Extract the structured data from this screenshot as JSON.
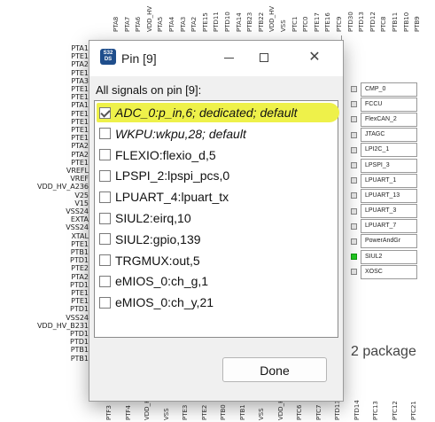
{
  "background": {
    "top_pins": [
      "PTA8",
      "PTA7",
      "PTA6",
      "VDD_HV",
      "PTA5",
      "PTA4",
      "PTA3",
      "PTA2",
      "PTE15",
      "PTD11",
      "PTD10",
      "PTA14",
      "PTB23",
      "PTB22",
      "VDD_HV",
      "VSS",
      "PTC1",
      "PTC0",
      "PTE17",
      "PTE16",
      "PTC9",
      "PTD30",
      "PTD13",
      "PTD12",
      "PTC8",
      "PTB11",
      "PTB10",
      "PTB9"
    ],
    "left_pins": [
      "PTA1",
      "PTE1",
      "PTA2",
      "PTE1",
      "PTA3",
      "PTE1",
      "PTE1",
      "PTA1",
      "PTE1",
      "PTE1",
      "PTE1",
      "PTE1",
      "PTA2",
      "PTA2",
      "PTE1",
      "VREFL",
      "VREF",
      "VDD_HV_A236",
      "V25",
      "V15",
      "VSS24",
      "EXTA",
      "VSS24",
      "XTAL",
      "PTE1",
      "PTB1",
      "PTD1",
      "PTE2",
      "PTA2",
      "PTD1",
      "PTE1",
      "PTE1",
      "PTD1",
      "VSS24",
      "VDD_HV_B231",
      "PTD1",
      "PTD1",
      "PTB1",
      "PTB1"
    ],
    "bottom_pins": [
      "PTF3",
      "PTF4",
      "VDD_HV",
      "VSS",
      "PTE3",
      "PTE2",
      "PTB0",
      "PTB1",
      "VSS",
      "VDD_HV",
      "PTC6",
      "PTC7",
      "PTD13",
      "PTD14",
      "PTC13",
      "PTC12",
      "PTC21"
    ],
    "peripherals": [
      {
        "label": "CMP_0",
        "active": false
      },
      {
        "label": "FCCU",
        "active": false
      },
      {
        "label": "FlexCAN_2",
        "active": false
      },
      {
        "label": "JTAGC",
        "active": false
      },
      {
        "label": "LPI2C_1",
        "active": false
      },
      {
        "label": "LPSPI_3",
        "active": false
      },
      {
        "label": "LPUART_1",
        "active": false
      },
      {
        "label": "LPUART_13",
        "active": false
      },
      {
        "label": "LPUART_3",
        "active": false
      },
      {
        "label": "LPUART_7",
        "active": false
      },
      {
        "label": "PowerAndGr",
        "active": false
      },
      {
        "label": "SIUL2",
        "active": true
      },
      {
        "label": "XOSC",
        "active": false
      }
    ],
    "package_label": "2 package"
  },
  "dialog": {
    "icon_text": "S32 DS",
    "title": "Pin [9]",
    "heading": "All signals on pin [9]:",
    "signals": [
      {
        "label": "ADC_0:p_in,6; dedicated; default",
        "checked": true,
        "italic": true,
        "highlighted": true
      },
      {
        "label": "WKPU:wkpu,28; default",
        "checked": false,
        "italic": true,
        "highlighted": false
      },
      {
        "label": "FLEXIO:flexio_d,5",
        "checked": false,
        "italic": false,
        "highlighted": false
      },
      {
        "label": "LPSPI_2:lpspi_pcs,0",
        "checked": false,
        "italic": false,
        "highlighted": false
      },
      {
        "label": "LPUART_4:lpuart_tx",
        "checked": false,
        "italic": false,
        "highlighted": false
      },
      {
        "label": "SIUL2:eirq,10",
        "checked": false,
        "italic": false,
        "highlighted": false
      },
      {
        "label": "SIUL2:gpio,139",
        "checked": false,
        "italic": false,
        "highlighted": false
      },
      {
        "label": "TRGMUX:out,5",
        "checked": false,
        "italic": false,
        "highlighted": false
      },
      {
        "label": "eMIOS_0:ch_g,1",
        "checked": false,
        "italic": false,
        "highlighted": false
      },
      {
        "label": "eMIOS_0:ch_y,21",
        "checked": false,
        "italic": false,
        "highlighted": false
      }
    ],
    "done_label": "Done",
    "colors": {
      "highlight": "#eef14a",
      "active_pin": "#22cc22"
    }
  }
}
